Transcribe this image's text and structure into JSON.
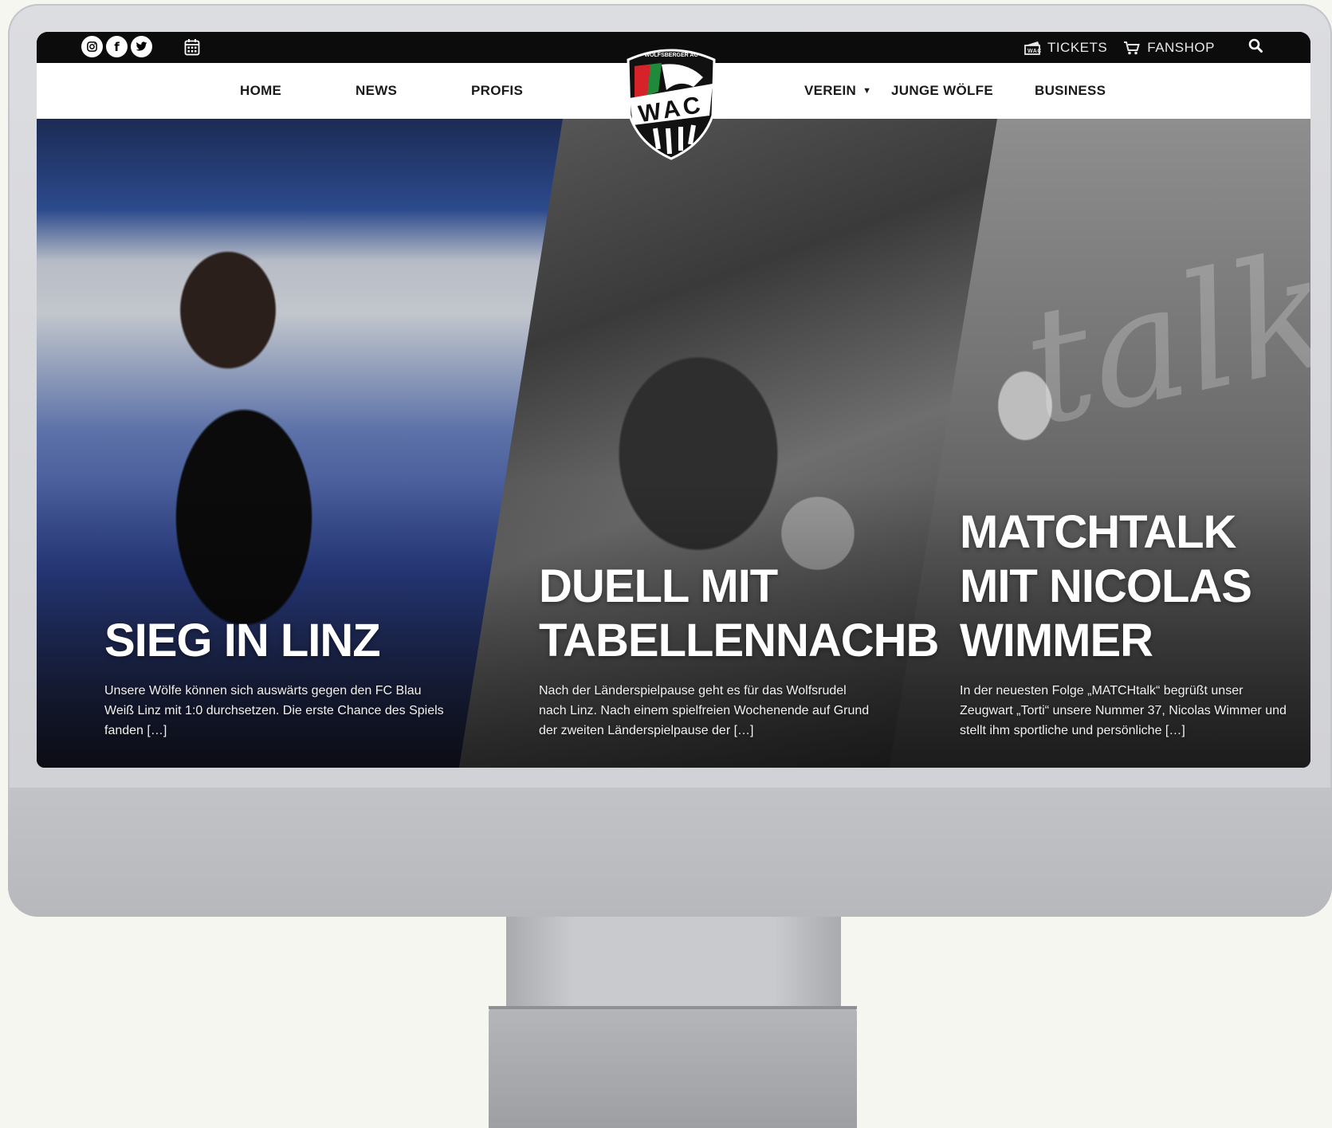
{
  "topbar": {
    "social_icons": [
      "instagram-icon",
      "facebook-icon",
      "twitter-icon"
    ],
    "calendar_icon": "calendar-icon",
    "tickets_label": "TICKETS",
    "fanshop_label": "FANSHOP",
    "search_icon": "search-icon"
  },
  "nav": {
    "items": [
      {
        "label": "HOME"
      },
      {
        "label": "NEWS"
      },
      {
        "label": "PROFIS"
      },
      {
        "label": "VEREIN"
      },
      {
        "label": "JUNGE WÖLFE"
      },
      {
        "label": "BUSINESS"
      }
    ]
  },
  "logo": {
    "top_text": "WOLFSBERGER AC",
    "letters": "WAC"
  },
  "colors": {
    "brand_red": "#d6232a",
    "brand_green": "#1f8a3a",
    "black": "#0c0c0c"
  },
  "hero": {
    "articles": [
      {
        "title": "SIEG IN LINZ",
        "excerpt": "Unsere Wölfe können sich auswärts gegen den FC Blau Weiß Linz mit 1:0 durchsetzen. Die erste Chance des Spiels fanden […]"
      },
      {
        "title": "DUELL MIT\nTABELLENNACHB",
        "excerpt": "Nach der Länderspielpause geht es für das Wolfsrudel nach Linz. Nach einem spielfreien Wochenende auf Grund der zweiten Länderspielpause der […]"
      },
      {
        "title": "MATCHTALK\nMIT NICOLAS\nWIMMER",
        "excerpt": "In der neuesten Folge „MATCHtalk“ begrüßt unser Zeugwart „Torti“ unsere Nummer 37, Nicolas Wimmer und stellt ihm sportliche und persönliche […]"
      }
    ]
  }
}
